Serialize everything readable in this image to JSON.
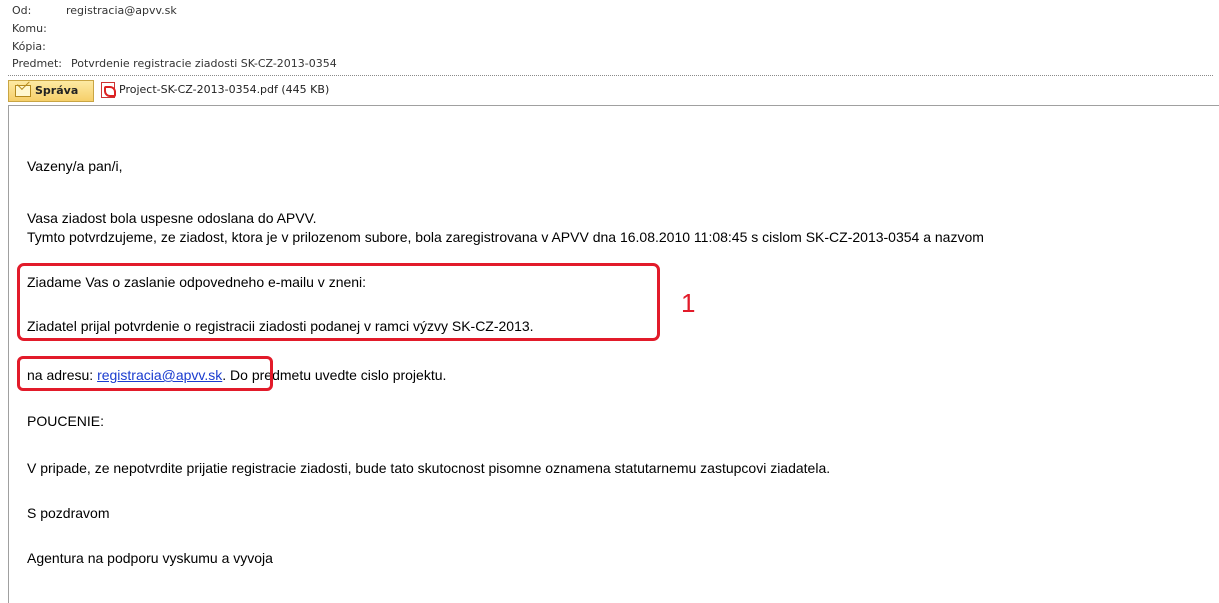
{
  "header": {
    "from_label": "Od:",
    "from_value": "registracia@apvv.sk",
    "to_label": "Komu:",
    "cc_label": "Kópia:",
    "subject_label": "Predmet:",
    "subject_value": "Potvrdenie registracie ziadosti SK-CZ-2013-0354"
  },
  "tabs": {
    "message_label": "Správa",
    "attachment_label": "Project-SK-CZ-2013-0354.pdf (445 KB)"
  },
  "body": {
    "greeting": "Vazeny/a pan/i,",
    "line1": "Vasa ziadost bola uspesne odoslana do APVV.",
    "line2": "Tymto potvrdzujeme, ze ziadost, ktora je v prilozenom subore, bola zaregistrovana v APVV dna 16.08.2010 11:08:45 s cislom SK-CZ-2013-0354 a nazvom",
    "request1": "Ziadame Vas o zaslanie odpovedneho e-mailu v zneni:",
    "request2": "Ziadatel prijal potvrdenie o registracii ziadosti podanej v ramci výzvy SK-CZ-2013.",
    "address_prefix": "na adresu: ",
    "address_link": "registracia@apvv.sk",
    "address_suffix": ". Do predmetu uvedte cislo projektu.",
    "notice_heading": "POUCENIE:",
    "notice_text": "V pripade, ze nepotvrdite prijatie registracie ziadosti, bude tato skutocnost pisomne oznamena statutarnemu zastupcovi ziadatela.",
    "closing": "S pozdravom",
    "signature": "Agentura na podporu vyskumu a vyvoja"
  },
  "annotations": {
    "callout_number": "1",
    "highlight_color": "#e21b2a"
  }
}
